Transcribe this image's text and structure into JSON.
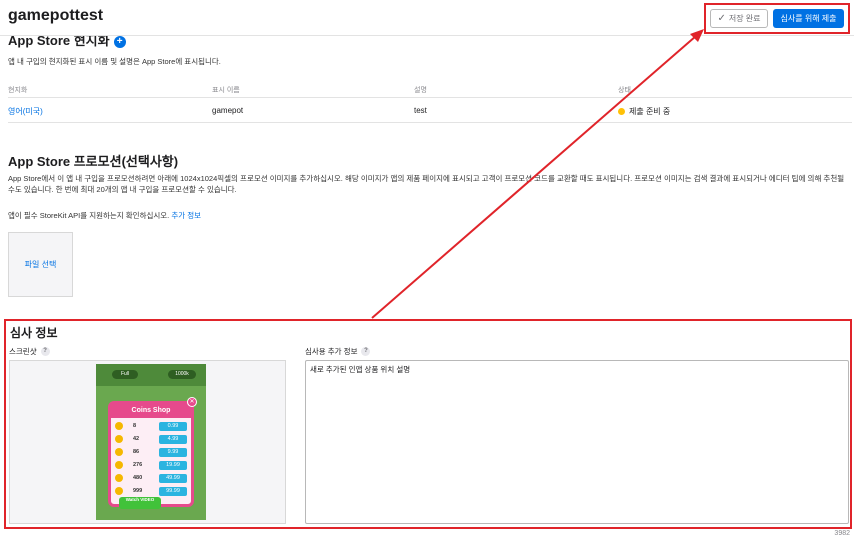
{
  "header": {
    "title": "gamepottest",
    "done_button": "저장 완료",
    "submit_button": "심사를 위해 제출"
  },
  "localization": {
    "title": "App Store 현지화",
    "description": "앱 내 구입의 현지화된 표시 이름 및 설명은 App Store에 표시됩니다.",
    "columns": [
      "현지화",
      "표시 이름",
      "설명",
      "상태"
    ],
    "rows": [
      {
        "locale": "영어(미국)",
        "display_name": "gamepot",
        "description": "test",
        "status": "제출 준비 중",
        "status_color": "#ffc107"
      }
    ]
  },
  "promotion": {
    "title": "App Store 프로모션(선택사항)",
    "description": "App Store에서 이 앱 내 구입을 프로모션하려면 아래에 1024x1024픽셀의 프로모션 이미지를 추가하십시오. 해당 이미지가 앱의 제품 페이지에 표시되고 고객이 프로모션 코드를 교환할 때도 표시됩니다. 프로모션 이미지는 검색 결과에 표시되거나 에디터 팁에 의해 추천될 수도 있습니다. 한 번에 최대 20개의 앱 내 구입을 프로모션할 수 있습니다.",
    "note": "앱이 필수 StoreKit API를 지원하는지 확인하십시오.",
    "note_link": "추가 정보",
    "file_button": "파일 선택"
  },
  "review": {
    "title": "심사 정보",
    "screenshot_label": "스크린샷",
    "notes_label": "심사용 추가 정보",
    "notes_value": "새로 추가된 인앱 상품 위치 설명",
    "counter": "3982",
    "game": {
      "hud_left": "Full",
      "hud_right": "1000k",
      "panel_title": "Coins Shop",
      "watch_label": "Watch VIDEO",
      "items": [
        {
          "amount": "8",
          "price": "0.99"
        },
        {
          "amount": "42",
          "price": "4.99"
        },
        {
          "amount": "86",
          "price": "9.99"
        },
        {
          "amount": "276",
          "price": "19.99"
        },
        {
          "amount": "480",
          "price": "49.99"
        },
        {
          "amount": "999",
          "price": "99.99"
        }
      ]
    }
  },
  "colors": {
    "accent": "#0071e3",
    "highlight": "#e0242a"
  }
}
